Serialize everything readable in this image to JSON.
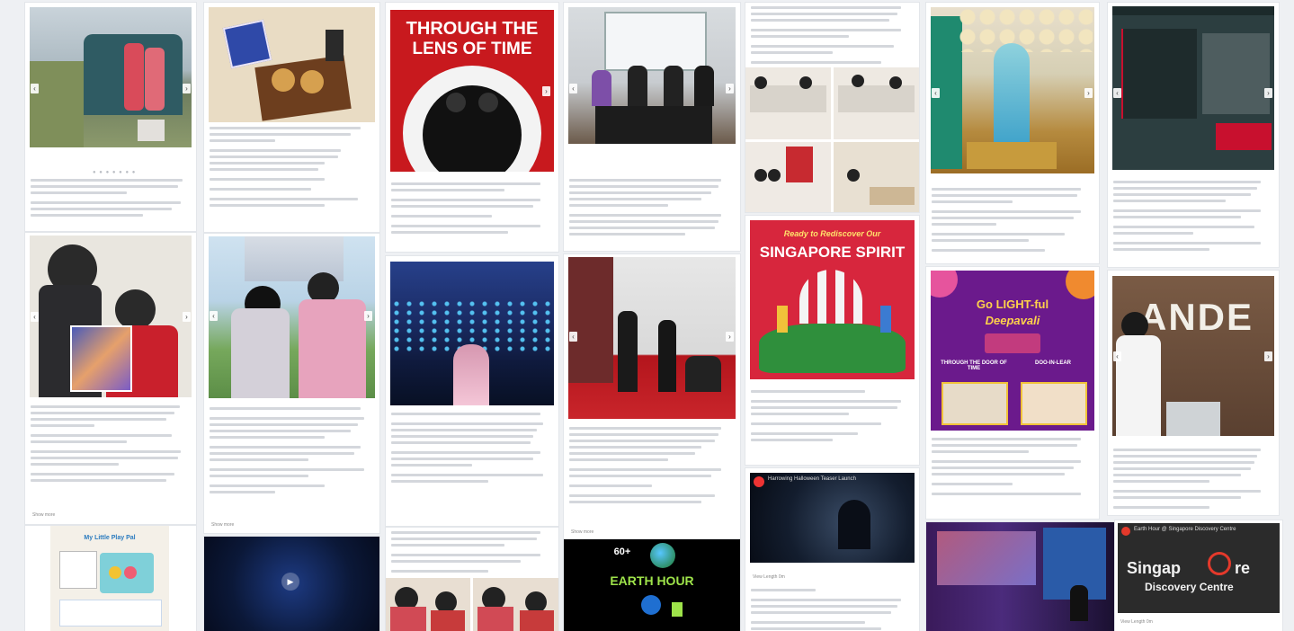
{
  "posts": {
    "p_lens": {
      "line1": "THROUGH THE",
      "line2": "LENS OF TIME"
    },
    "p_spirit": {
      "line1": "Ready to Rediscover Our",
      "line2": "SINGAPORE SPIRIT"
    },
    "p_deepavali": {
      "line1": "Go LIGHT-ful",
      "line2": "Deepavali",
      "cta1": "THROUGH THE DOOR OF TIME",
      "cta2": "DOO-IN-LEAR"
    },
    "p_ande": {
      "text": "ANDE"
    },
    "p_earth": {
      "badge": "60+",
      "line1": "EARTH HOUR"
    },
    "p_earth2": {
      "header": "Earth Hour @ Singapore Discovery Centre",
      "brand1": "Singap",
      "brand2": "re",
      "brand3": "Discovery Centre"
    },
    "p_halloween": {
      "header": "Harrowing Halloween Teaser Launch"
    },
    "p_mylittle": {
      "title": "My Little Play Pal"
    }
  },
  "ui": {
    "show_more": "Show more",
    "view_length": "View Length 0m",
    "arrow_left": "‹",
    "arrow_right": "›",
    "dots": "● ● ● ● ● ● ●",
    "play": "▶"
  },
  "colors": {
    "background": "#eef0f3",
    "card": "#ffffff",
    "text_line": "#d4d7dc",
    "lens_red": "#c8191e",
    "spirit_red": "#d7263d",
    "deepavali_purple": "#6b1a8c",
    "dark_navy": "#0c1c3a"
  }
}
